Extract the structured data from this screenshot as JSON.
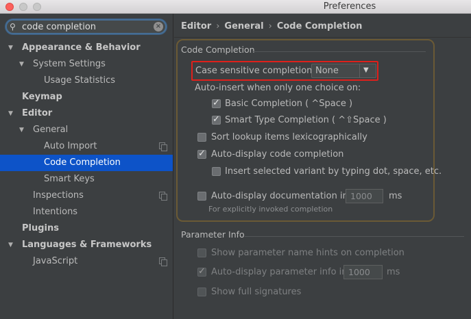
{
  "window": {
    "title": "Preferences"
  },
  "search": {
    "value": "code completion"
  },
  "tree": [
    {
      "label": "Appearance & Behavior",
      "bold": true,
      "arrow": "▼",
      "level": 0
    },
    {
      "label": "System Settings",
      "bold": false,
      "arrow": "▼",
      "level": 1
    },
    {
      "label": "Usage Statistics",
      "bold": false,
      "arrow": "",
      "level": 2
    },
    {
      "label": "Keymap",
      "bold": true,
      "arrow": "",
      "level": 0
    },
    {
      "label": "Editor",
      "bold": true,
      "arrow": "▼",
      "level": 0
    },
    {
      "label": "General",
      "bold": false,
      "arrow": "▼",
      "level": 1
    },
    {
      "label": "Auto Import",
      "bold": false,
      "arrow": "",
      "level": 2,
      "copy": true
    },
    {
      "label": "Code Completion",
      "bold": false,
      "arrow": "",
      "level": 2,
      "selected": true
    },
    {
      "label": "Smart Keys",
      "bold": false,
      "arrow": "",
      "level": 2
    },
    {
      "label": "Inspections",
      "bold": false,
      "arrow": "",
      "level": 1,
      "copy": true
    },
    {
      "label": "Intentions",
      "bold": false,
      "arrow": "",
      "level": 1
    },
    {
      "label": "Plugins",
      "bold": true,
      "arrow": "",
      "level": 0
    },
    {
      "label": "Languages & Frameworks",
      "bold": true,
      "arrow": "▼",
      "level": 0
    },
    {
      "label": "JavaScript",
      "bold": false,
      "arrow": "",
      "level": 1,
      "copy": true
    }
  ],
  "breadcrumb": {
    "editor": "Editor",
    "general": "General",
    "current": "Code Completion",
    "separator": "›"
  },
  "code_completion": {
    "title": "Code Completion",
    "case_sensitive_label": "Case sensitive completion:",
    "case_sensitive_value": "None",
    "auto_insert_label": "Auto-insert when only one choice on:",
    "basic_completion": "Basic Completion ( ^Space )",
    "smart_type_completion": "Smart Type Completion ( ^⇧Space )",
    "sort_lookup": "Sort lookup items lexicographically",
    "auto_display_code": "Auto-display code completion",
    "insert_selected_variant": "Insert selected variant by typing dot, space, etc.",
    "auto_display_doc": "Auto-display documentation in",
    "auto_display_doc_value": "1000",
    "auto_display_doc_unit": "ms",
    "auto_display_doc_hint": "For explicitly invoked completion"
  },
  "parameter_info": {
    "title": "Parameter Info",
    "show_name_hints": "Show parameter name hints on completion",
    "auto_display_param": "Auto-display parameter info in",
    "auto_display_param_value": "1000",
    "auto_display_param_unit": "ms",
    "show_full_signatures": "Show full signatures"
  },
  "colors": {
    "selection": "#0d53c8",
    "highlight_border": "#e0201b",
    "group_border": "#6b5a35"
  }
}
